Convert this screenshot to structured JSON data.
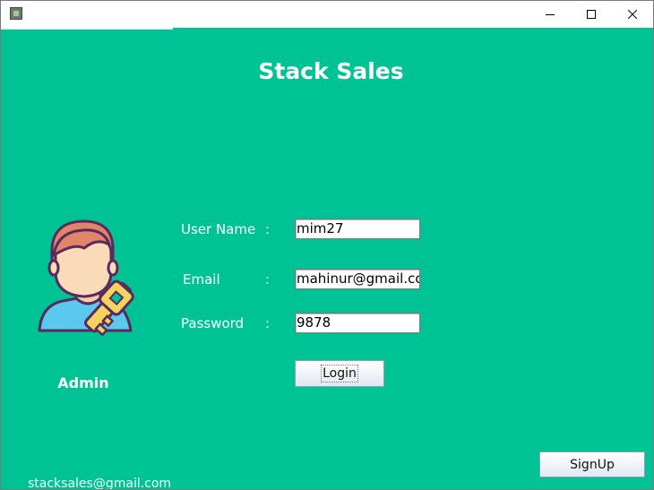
{
  "titlebar": {
    "app_icon": "java-app-icon",
    "minimize_icon": "minimize-icon",
    "maximize_icon": "maximize-icon",
    "close_icon": "close-icon"
  },
  "app": {
    "title": "Stack Sales",
    "accent_color": "#00c395"
  },
  "admin": {
    "label": "Admin",
    "icon": "admin-key-avatar-icon"
  },
  "form": {
    "username_label": "User Name",
    "email_label": "Email",
    "password_label": "Password",
    "colon": ":",
    "username_value": "mim27",
    "email_value": "mahinur@gmail.co",
    "password_value": "9878",
    "login_label": "Login"
  },
  "signup_label": "SignUp",
  "footer": {
    "email": "stacksales@gmail.com"
  }
}
